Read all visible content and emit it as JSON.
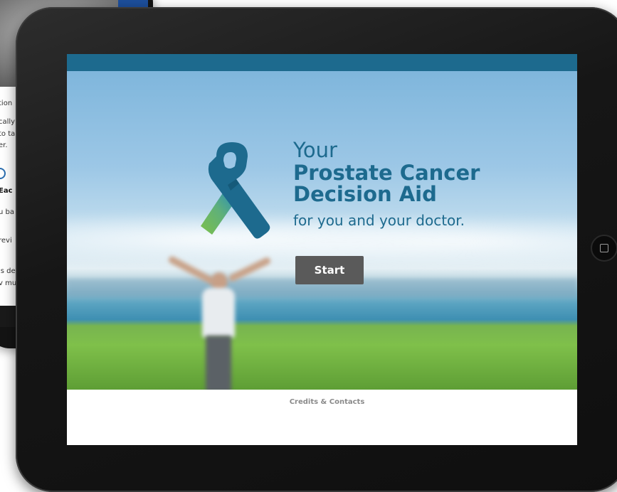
{
  "background_tablet": {
    "text_lines": [
      "tion",
      "cally",
      "to ta",
      "er.",
      "Eac",
      "u ba",
      "revi",
      "is de",
      "v mu"
    ]
  },
  "app": {
    "hero": {
      "title_line1": "Your",
      "title_line2": "Prostate Cancer",
      "title_line3": "Decision Aid",
      "subtitle": "for you and your doctor.",
      "start_label": "Start"
    },
    "footer": {
      "credits_label": "Credits & Contacts"
    }
  },
  "colors": {
    "brand_blue": "#1d6a8e",
    "top_bar": "#1d6a8e",
    "start_button": "#5a5a5a",
    "logo_green": "#7cc04a",
    "logo_blue": "#2a8fb9"
  },
  "icons": {
    "logo": "awareness-ribbon-icon",
    "home": "home-button-icon"
  }
}
